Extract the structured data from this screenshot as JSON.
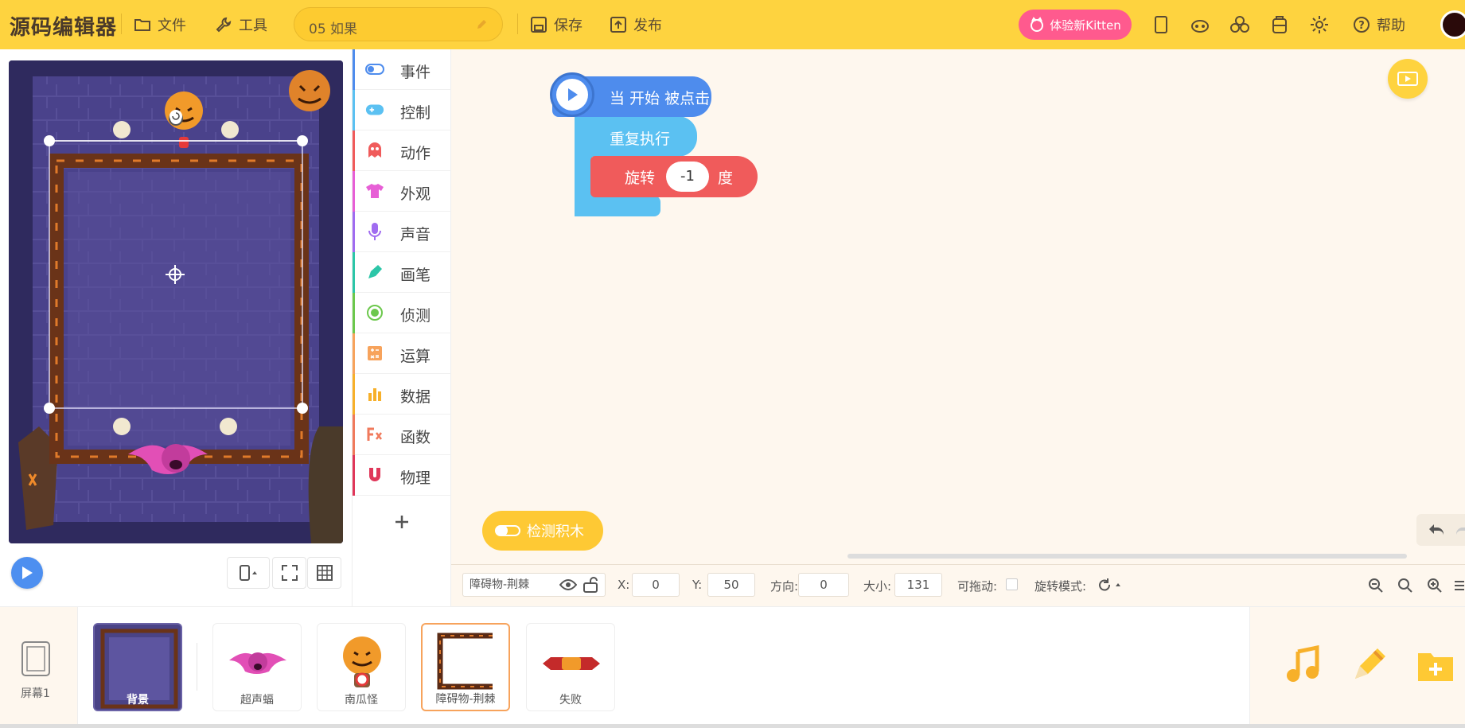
{
  "app": {
    "logo": "源码编辑器",
    "menu_file": "文件",
    "menu_tools": "工具",
    "project_title": "05 如果",
    "save": "保存",
    "publish": "发布",
    "kitten": "体验新Kitten",
    "help": "帮助"
  },
  "categories": [
    {
      "label": "事件",
      "color": "#4e8ced"
    },
    {
      "label": "控制",
      "color": "#5bc1f2"
    },
    {
      "label": "动作",
      "color": "#f05b5b"
    },
    {
      "label": "外观",
      "color": "#e75fd6"
    },
    {
      "label": "声音",
      "color": "#a06cf0"
    },
    {
      "label": "画笔",
      "color": "#2cc6a8"
    },
    {
      "label": "侦测",
      "color": "#6cc84c"
    },
    {
      "label": "运算",
      "color": "#f7a35c"
    },
    {
      "label": "数据",
      "color": "#f7b02a"
    },
    {
      "label": "函数",
      "color": "#f07a5c"
    },
    {
      "label": "物理",
      "color": "#e0375a"
    }
  ],
  "blocks": {
    "hat": "当 开始 被点击",
    "loop": "重复执行",
    "rotate_prefix": "旋转",
    "rotate_value": "-1",
    "rotate_suffix": "度"
  },
  "workspace": {
    "detect_button": "检测积木"
  },
  "props": {
    "sprite_name": "障碍物-荆棘",
    "x_label": "X:",
    "x": "0",
    "y_label": "Y:",
    "y": "50",
    "dir_label": "方向:",
    "dir": "0",
    "size_label": "大小:",
    "size": "131",
    "drag_label": "可拖动:",
    "rotmode_label": "旋转模式:"
  },
  "sprites": {
    "screen": "屏幕1",
    "background": "背景",
    "items": [
      "超声蝠",
      "南瓜怪",
      "障碍物-荆棘",
      "失败"
    ]
  }
}
